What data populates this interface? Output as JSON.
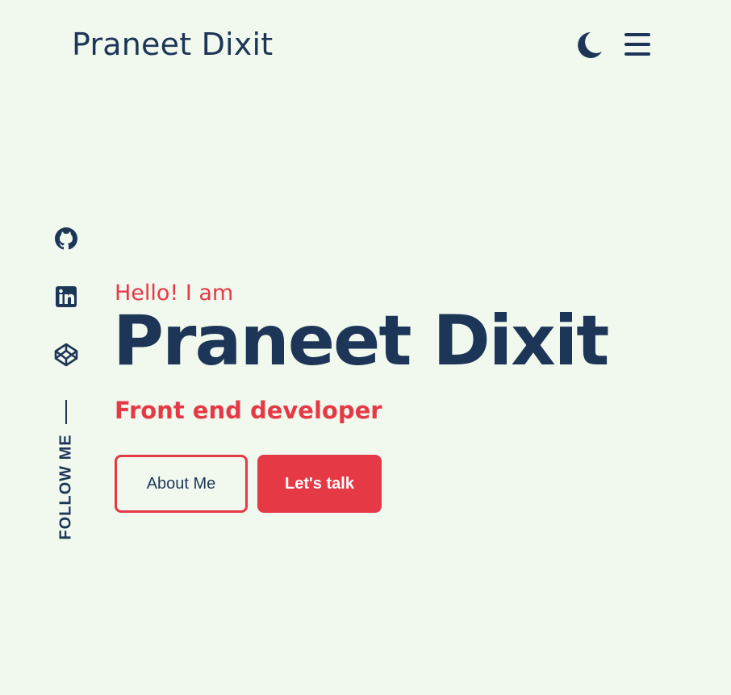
{
  "header": {
    "logo_text": "Praneet Dixit",
    "theme_icon": "moon-icon",
    "menu_icon": "hamburger-menu-icon"
  },
  "social": {
    "links": [
      {
        "icon": "github-icon"
      },
      {
        "icon": "linkedin-icon"
      },
      {
        "icon": "codepen-icon"
      }
    ],
    "follow_text": "FOLLOW ME"
  },
  "hero": {
    "greeting": "Hello! I am",
    "name": "Praneet Dixit",
    "role": "Front end developer",
    "about_button": "About Me",
    "talk_button": "Let's talk"
  },
  "colors": {
    "background": "#f1f9ef",
    "primary": "#1d3557",
    "accent": "#e63946"
  }
}
